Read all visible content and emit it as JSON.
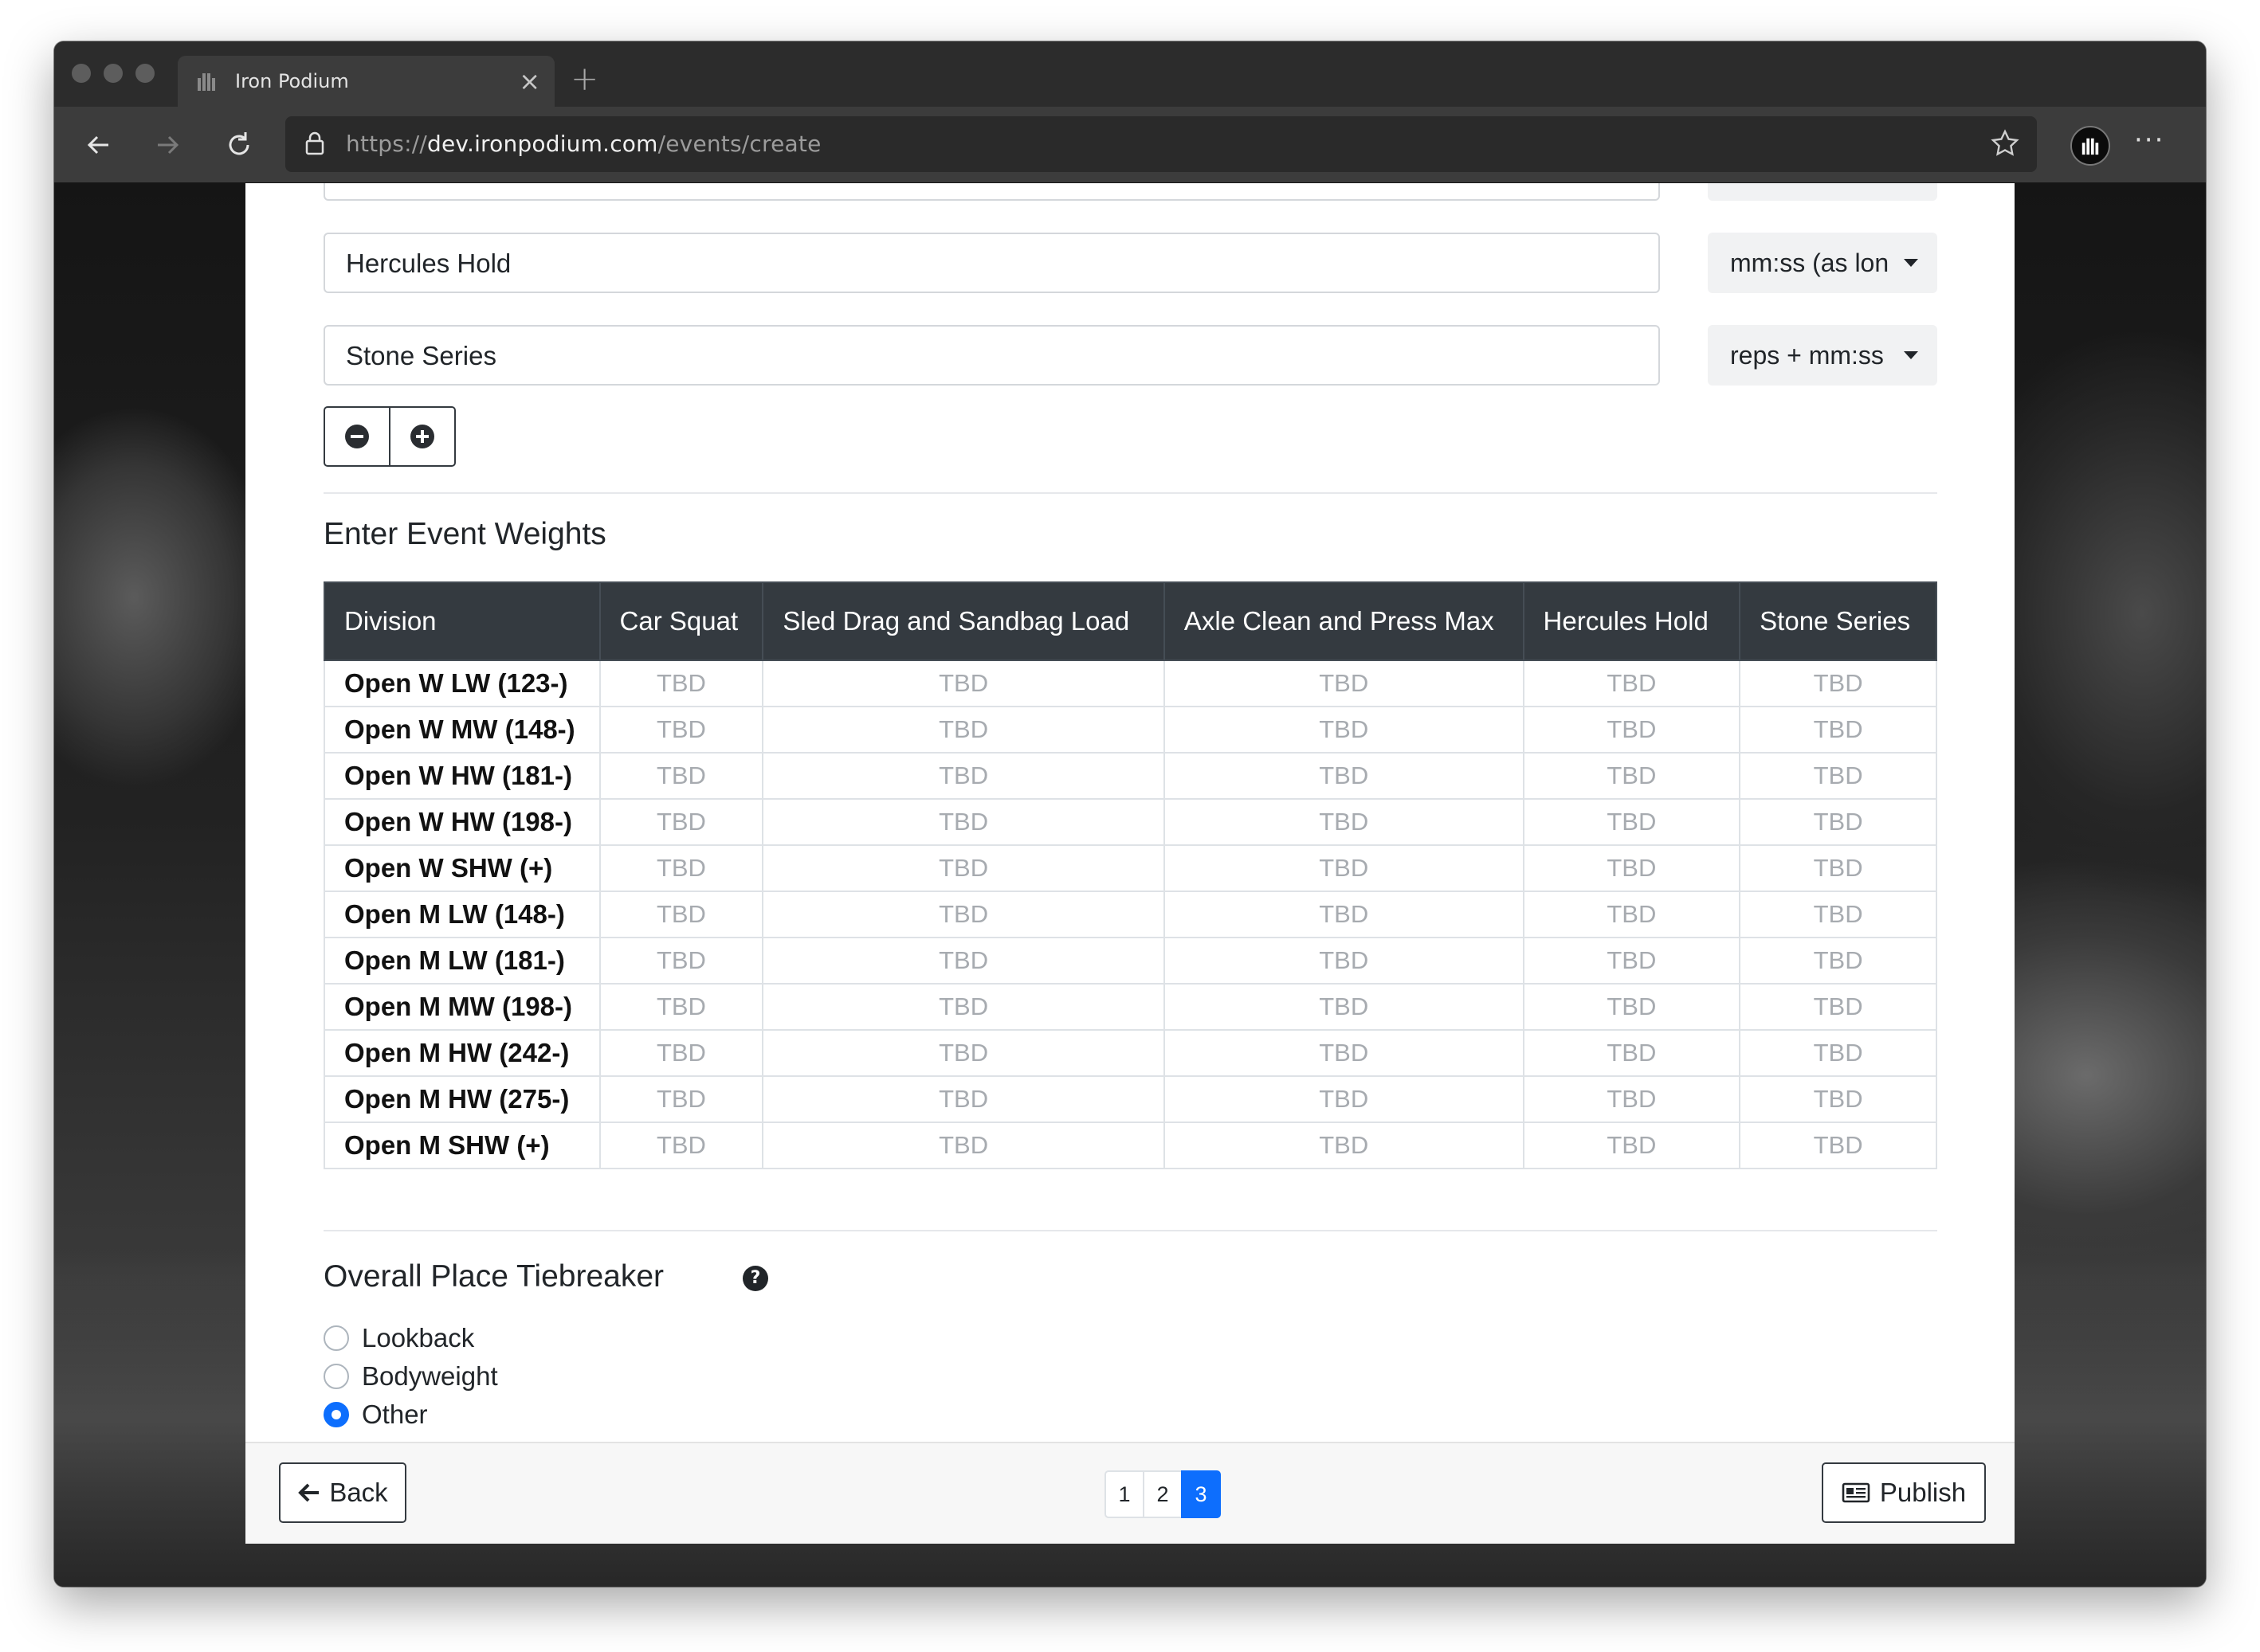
{
  "browser": {
    "tab_title": "Iron Podium",
    "url_scheme": "https://",
    "url_host": "dev.ironpodium.com",
    "url_path": "/events/create"
  },
  "events": [
    {
      "name": "Hercules Hold",
      "format": "mm:ss (as lon"
    },
    {
      "name": "Stone Series",
      "format": "reps + mm:ss"
    }
  ],
  "weights_section": {
    "title": "Enter Event Weights",
    "columns": [
      "Division",
      "Car Squat",
      "Sled Drag and Sandbag Load",
      "Axle Clean and Press Max",
      "Hercules Hold",
      "Stone Series"
    ],
    "placeholder": "TBD",
    "divisions": [
      "Open W LW (123-)",
      "Open W MW (148-)",
      "Open W HW (181-)",
      "Open W HW (198-)",
      "Open W SHW (+)",
      "Open M LW (148-)",
      "Open M LW (181-)",
      "Open M MW (198-)",
      "Open M HW (242-)",
      "Open M HW (275-)",
      "Open M SHW (+)"
    ]
  },
  "tiebreaker": {
    "title": "Overall Place Tiebreaker",
    "options": [
      {
        "label": "Lookback",
        "checked": false
      },
      {
        "label": "Bodyweight",
        "checked": false
      },
      {
        "label": "Other",
        "checked": true
      }
    ]
  },
  "footer": {
    "back_label": "Back",
    "pages": [
      "1",
      "2",
      "3"
    ],
    "active_page": "3",
    "publish_label": "Publish"
  },
  "colors": {
    "accent": "#0d6efd",
    "table_header": "#343a40",
    "placeholder_text": "#a7abb0"
  }
}
